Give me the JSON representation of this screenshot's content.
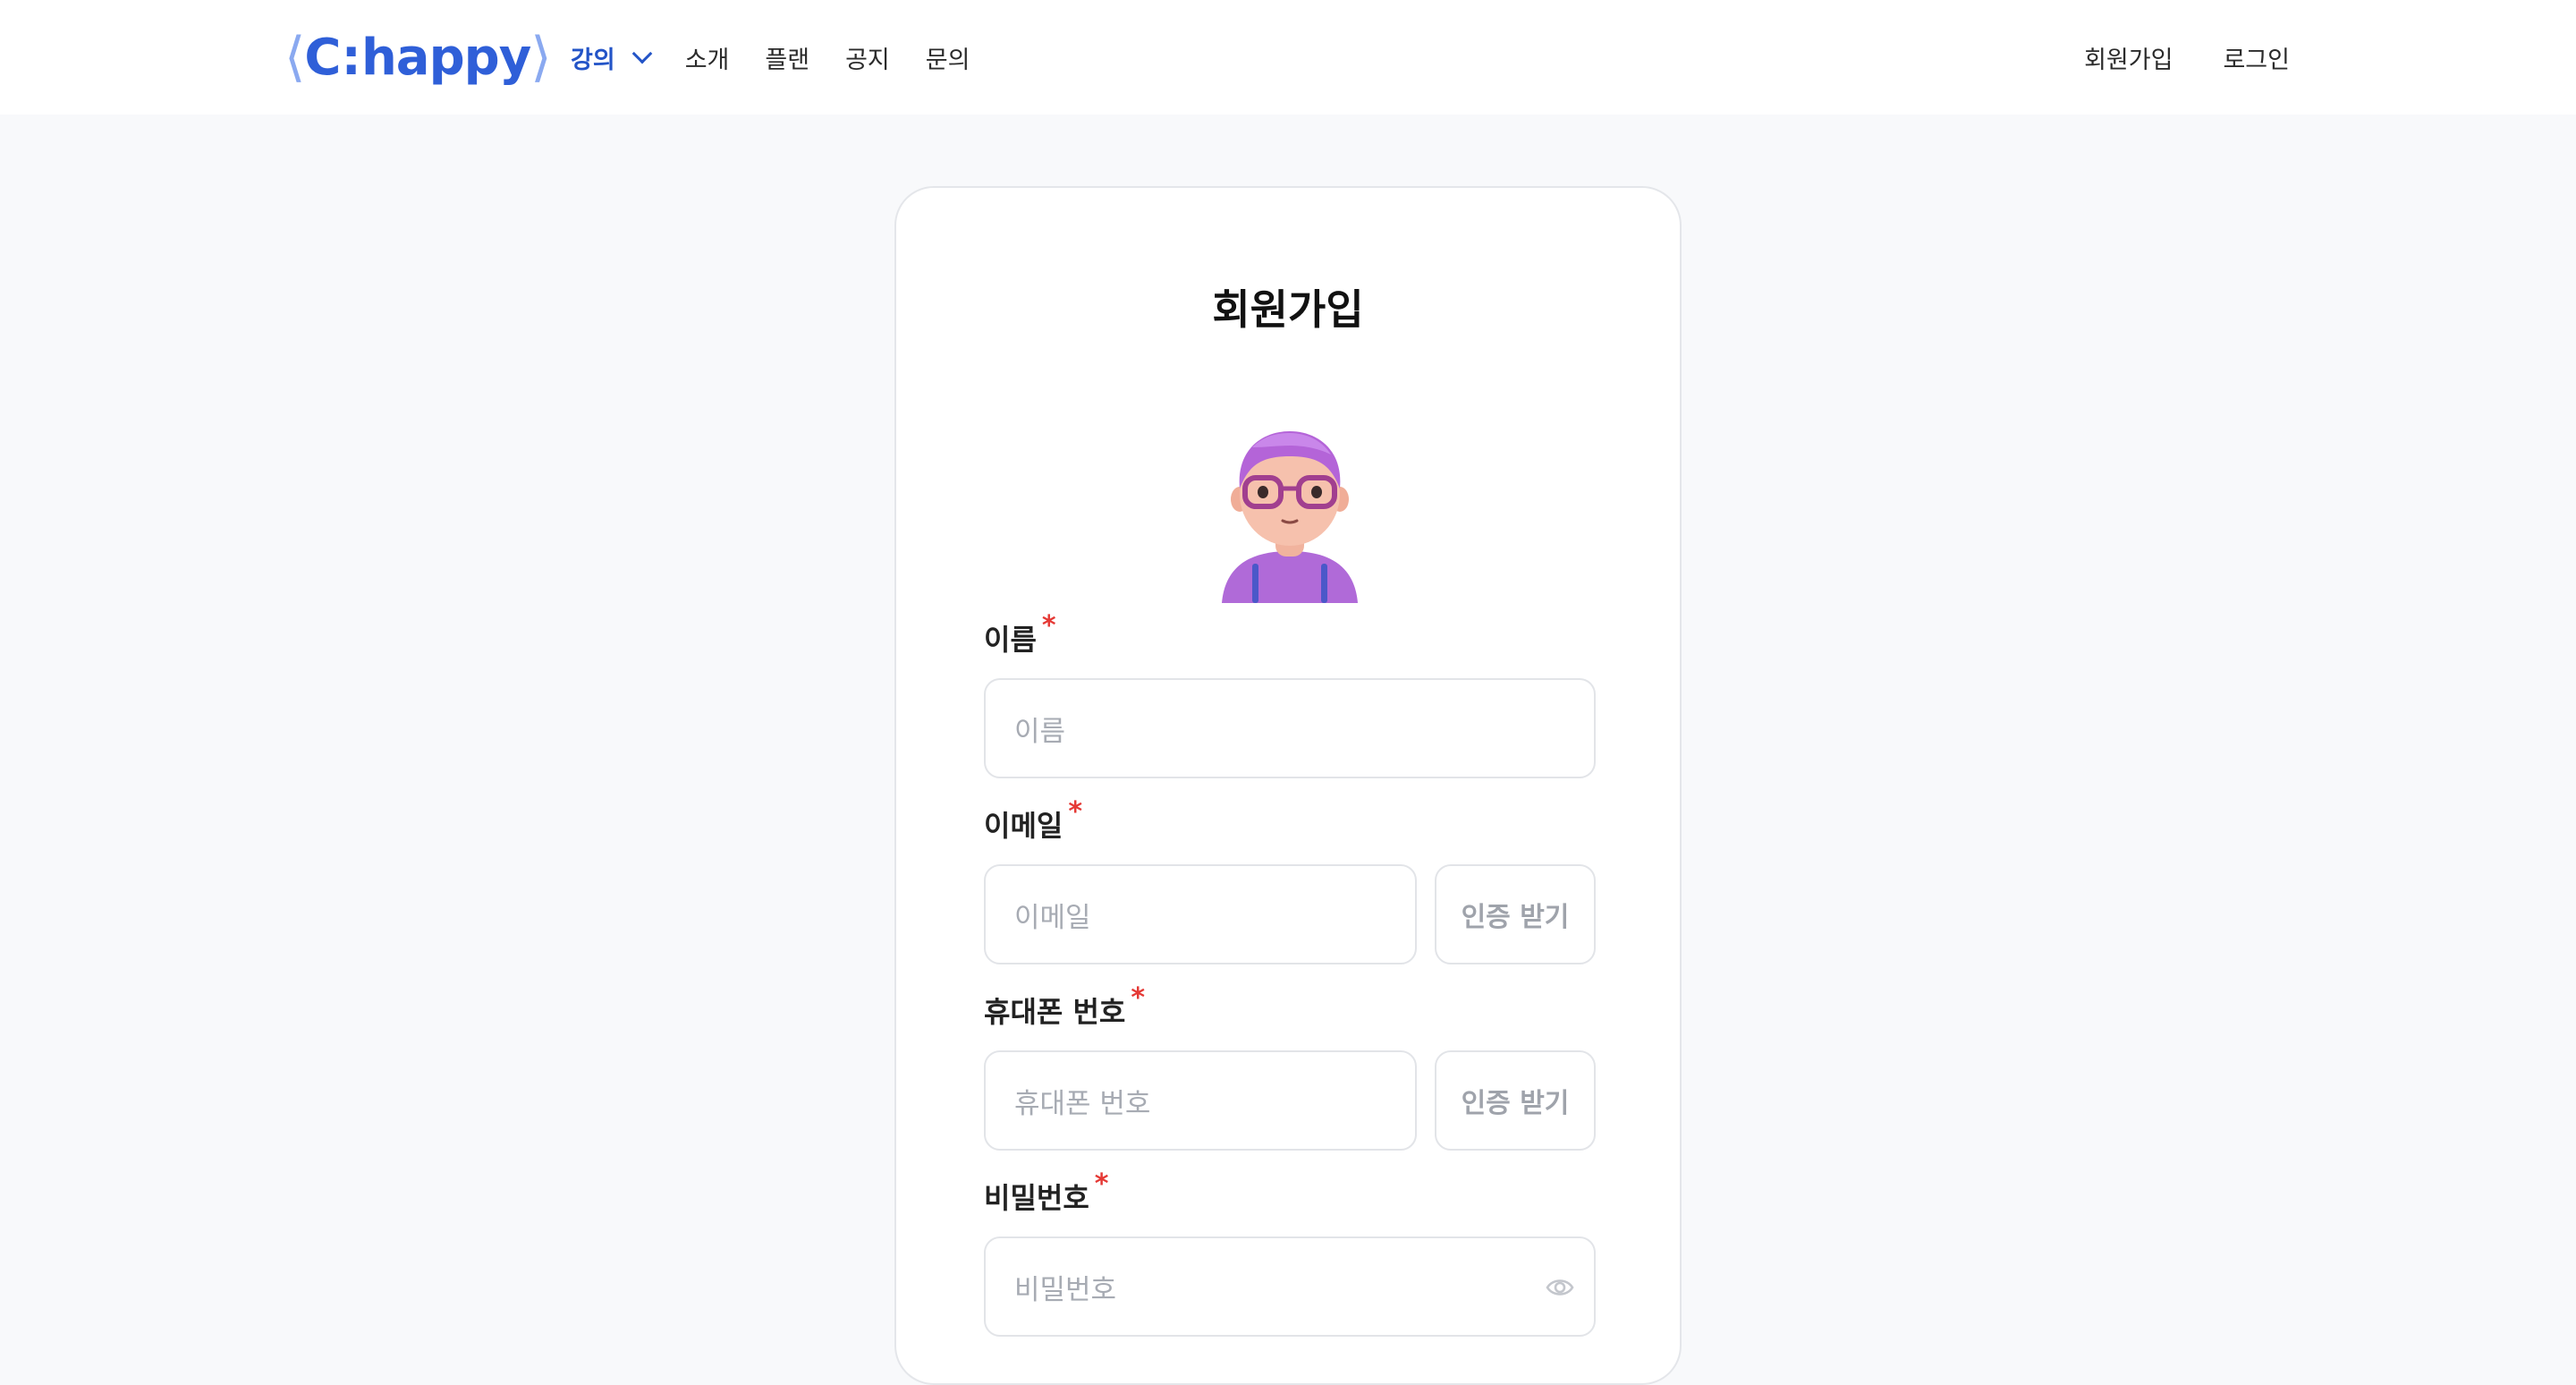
{
  "header": {
    "logo": {
      "left_bracket": "⟨",
      "c": "C",
      "colon": ":",
      "word": "happy",
      "right_bracket": "⟩"
    },
    "nav": [
      {
        "label": "강의",
        "active": true,
        "has_dropdown": true
      },
      {
        "label": "소개"
      },
      {
        "label": "플랜"
      },
      {
        "label": "공지"
      },
      {
        "label": "문의"
      }
    ],
    "auth": {
      "signup_label": "회원가입",
      "login_label": "로그인"
    }
  },
  "form": {
    "title": "회원가입",
    "required_mark": "*",
    "name": {
      "label": "이름",
      "placeholder": "이름"
    },
    "email": {
      "label": "이메일",
      "placeholder": "이메일",
      "button": "인증 받기"
    },
    "phone": {
      "label": "휴대폰 번호",
      "placeholder": "휴대폰 번호",
      "button": "인증 받기"
    },
    "password": {
      "label": "비밀번호",
      "placeholder": "비밀번호",
      "icon": "eye-icon"
    }
  },
  "colors": {
    "brand": "#2f5fd8",
    "nav_active": "#2354c7",
    "required": "#e53935",
    "page_bg": "#f8f9fb"
  }
}
